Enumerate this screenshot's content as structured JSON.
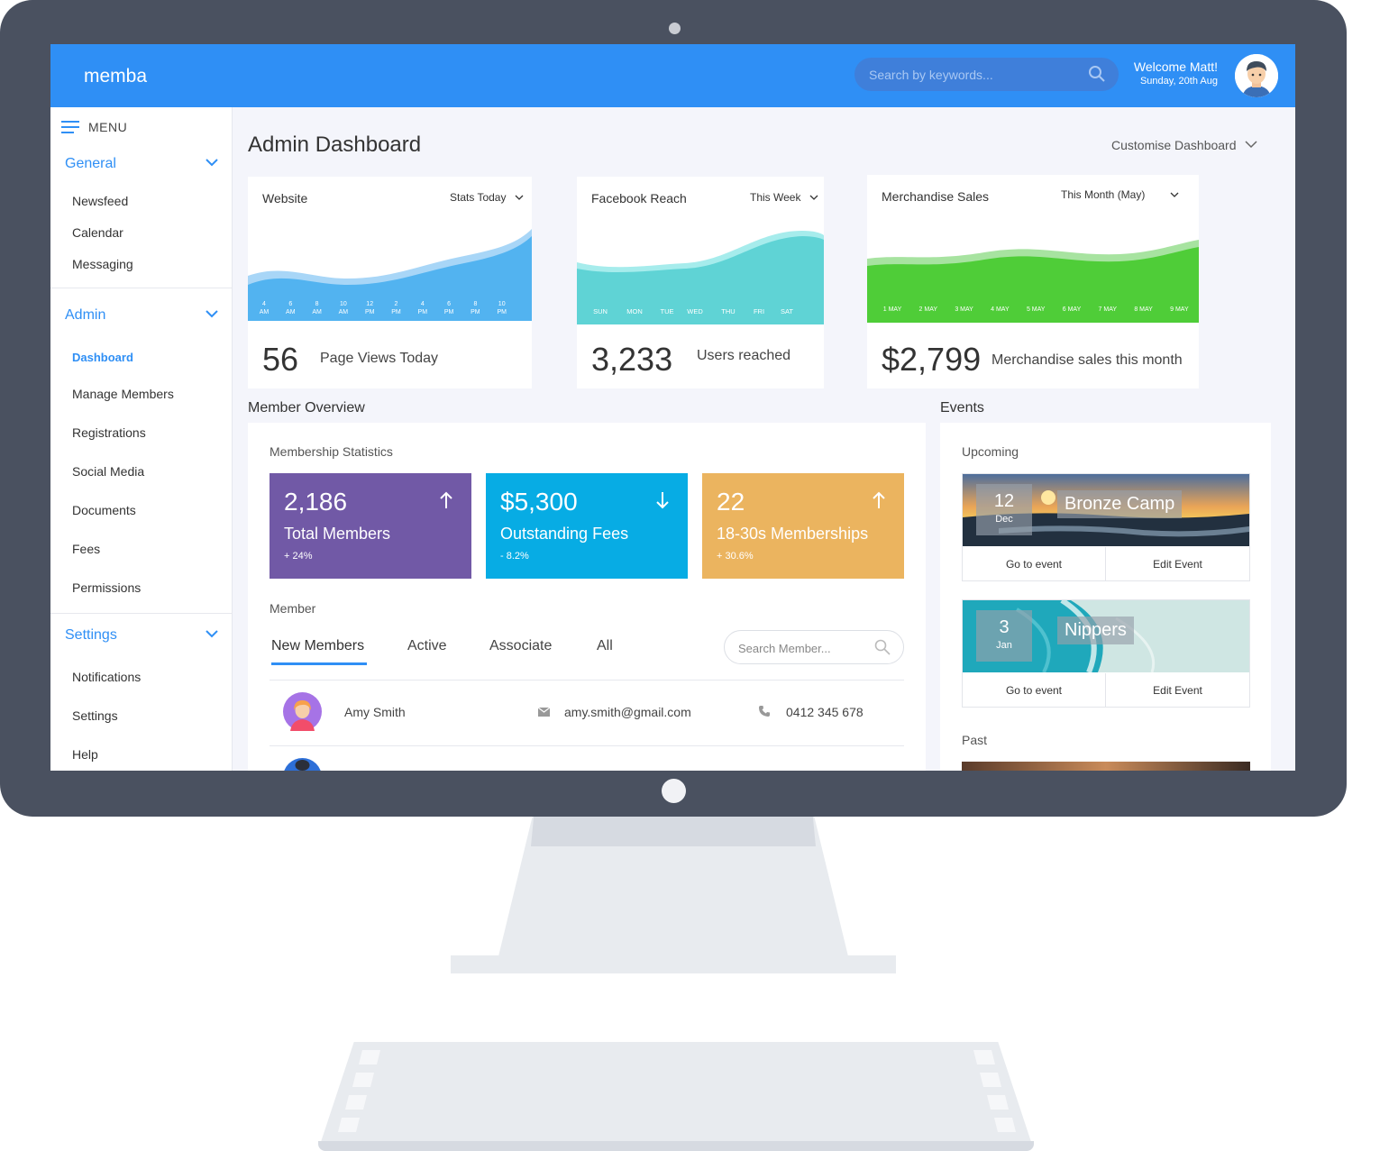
{
  "app": {
    "logo": "memba"
  },
  "header": {
    "search_placeholder": "Search by keywords...",
    "welcome": "Welcome Matt!",
    "date": "Sunday, 20th Aug"
  },
  "sidebar": {
    "menu_label": "MENU",
    "sections": [
      {
        "title": "General",
        "items": [
          "Newsfeed",
          "Calendar",
          "Messaging"
        ]
      },
      {
        "title": "Admin",
        "items": [
          "Dashboard",
          "Manage Members",
          "Registrations",
          "Social Media",
          "Documents",
          "Fees",
          "Permissions"
        ]
      },
      {
        "title": "Settings",
        "items": [
          "Notifications",
          "Settings",
          "Help"
        ]
      }
    ],
    "active_item": "Dashboard"
  },
  "page": {
    "title": "Admin Dashboard",
    "customise": "Customise Dashboard"
  },
  "cards": [
    {
      "title": "Website",
      "filter": "Stats Today",
      "value": "56",
      "label": "Page Views Today",
      "x_ticks": [
        [
          "4",
          "AM"
        ],
        [
          "6",
          "AM"
        ],
        [
          "8",
          "AM"
        ],
        [
          "10",
          "AM"
        ],
        [
          "12",
          "PM"
        ],
        [
          "2",
          "PM"
        ],
        [
          "4",
          "PM"
        ],
        [
          "6",
          "PM"
        ],
        [
          "8",
          "PM"
        ],
        [
          "10",
          "PM"
        ]
      ]
    },
    {
      "title": "Facebook Reach",
      "filter": "This Week",
      "value": "3,233",
      "label": "Users reached",
      "x_ticks": [
        "SUN",
        "MON",
        "TUE",
        "WED",
        "THU",
        "FRI",
        "SAT"
      ]
    },
    {
      "title": "Merchandise Sales",
      "filter": "This Month (May)",
      "value": "$2,799",
      "label": "Merchandise sales this month",
      "x_ticks": [
        "1 MAY",
        "2 MAY",
        "3 MAY",
        "4 MAY",
        "5 MAY",
        "6 MAY",
        "7 MAY",
        "8 MAY",
        "9 MAY"
      ]
    }
  ],
  "member_overview": {
    "title": "Member Overview",
    "stats_title": "Membership Statistics",
    "stats": [
      {
        "value": "2,186",
        "label": "Total Members",
        "change": "+ 24%",
        "direction": "up",
        "color": "#7159a6"
      },
      {
        "value": "$5,300",
        "label": "Outstanding Fees",
        "change": "- 8.2%",
        "direction": "down",
        "color": "#07ace4"
      },
      {
        "value": "22",
        "label": "18-30s Memberships",
        "change": "+ 30.6%",
        "direction": "up",
        "color": "#ebb45f"
      }
    ],
    "member_title": "Member",
    "tabs": [
      "New Members",
      "Active",
      "Associate",
      "All"
    ],
    "search_placeholder": "Search Member...",
    "rows": [
      {
        "name": "Amy Smith",
        "email": "amy.smith@gmail.com",
        "phone": "0412 345 678"
      }
    ]
  },
  "events": {
    "title": "Events",
    "upcoming_title": "Upcoming",
    "past_title": "Past",
    "upcoming": [
      {
        "day": "12",
        "month": "Dec",
        "name": "Bronze Camp",
        "go": "Go to event",
        "edit": "Edit Event"
      },
      {
        "day": "3",
        "month": "Jan",
        "name": "Nippers",
        "go": "Go to event",
        "edit": "Edit Event"
      }
    ]
  },
  "colors": {
    "primary": "#2f8ff5",
    "frame": "#4a5160"
  }
}
